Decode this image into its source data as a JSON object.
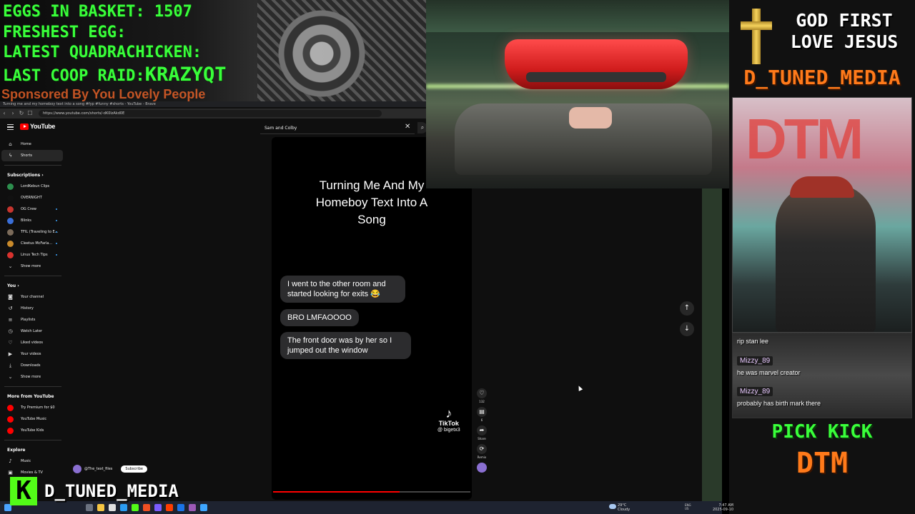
{
  "overlay": {
    "eggs_in_basket": "EGGS IN BASKET: 1507",
    "freshest_egg": "FRESHEST EGG:",
    "latest_quadrachicken": "LATEST QUADRACHICKEN:",
    "last_coop_raid_label": "LAST COOP RAID:",
    "last_coop_raid_value": "KRAZYQT",
    "sponsored": "Sponsored By You Lovely People",
    "god_first_line1": "GOD FIRST",
    "god_first_line2": "LOVE JESUS",
    "channel_header": "D_TUNED_MEDIA",
    "pick_kick": "PICK KICK",
    "dtm_footer": "DTM",
    "kick_brand_letter": "K",
    "kick_brand_name": "D_TUNED_MEDIA",
    "face_cam_sign": "DTM"
  },
  "browser": {
    "tab_title": "Turning me and my homeboy text into a song #fyp #funny #shorts - YouTube - Brave",
    "url": "https://www.youtube.com/shorts/-dK0lzAkd0E",
    "nav": {
      "back": "‹",
      "forward": "›",
      "reload": "↻",
      "bookmark": "☐"
    }
  },
  "youtube": {
    "logo_text": "YouTube",
    "search_value": "Sam and Colby",
    "search_clear": "✕",
    "search_icon": "⌕",
    "sidebar": {
      "main": [
        {
          "label": "Home",
          "icon": "home-icon",
          "glyph": "⌂"
        },
        {
          "label": "Shorts",
          "icon": "shorts-icon",
          "glyph": "ϟ",
          "active": true
        }
      ],
      "subscriptions_header": "Subscriptions  ›",
      "subscriptions": [
        {
          "label": "LordKebun Clips",
          "color": "#2d8f4e"
        },
        {
          "label": "OVERNIGHT",
          "color": "#111111"
        },
        {
          "label": "OG Crew",
          "color": "#c7352e"
        },
        {
          "label": "Blinks",
          "color": "#3a6fd8"
        },
        {
          "label": "TFIL (Traveling to E...",
          "color": "#7b6b5a"
        },
        {
          "label": "Cleetus McFarla...",
          "color": "#c98a2b"
        },
        {
          "label": "Linus Tech Tips",
          "color": "#d8322e"
        }
      ],
      "show_more_1": "Show more",
      "you_header": "You  ›",
      "you_items": [
        {
          "label": "Your channel",
          "icon": "your-channel-icon",
          "glyph": "◙"
        },
        {
          "label": "History",
          "icon": "history-icon",
          "glyph": "↺"
        },
        {
          "label": "Playlists",
          "icon": "playlists-icon",
          "glyph": "≡"
        },
        {
          "label": "Watch Later",
          "icon": "watch-later-icon",
          "glyph": "◷"
        },
        {
          "label": "Liked videos",
          "icon": "liked-videos-icon",
          "glyph": "♡"
        },
        {
          "label": "Your videos",
          "icon": "your-videos-icon",
          "glyph": "▶"
        },
        {
          "label": "Downloads",
          "icon": "downloads-icon",
          "glyph": "⤓"
        }
      ],
      "show_more_2": "Show more",
      "more_header": "More from YouTube",
      "more_items": [
        {
          "label": "Try Premium for $0",
          "color": "#ff0000"
        },
        {
          "label": "YouTube Music",
          "color": "#ff0000"
        },
        {
          "label": "YouTube Kids",
          "color": "#ff0000"
        }
      ],
      "explore_header": "Explore",
      "explore_items": [
        {
          "label": "Music",
          "icon": "music-icon",
          "glyph": "♪"
        },
        {
          "label": "Movies & TV",
          "icon": "movies-icon",
          "glyph": "▣"
        }
      ]
    },
    "short": {
      "title_line1": "Turning Me And My",
      "title_line2": "Homeboy Text Into A",
      "title_line3": "Song",
      "bubble1": "I went to the other room and started looking for exits 😂",
      "bubble2": "BRO LMFAOOOO",
      "bubble3": "The front door was by her so I jumped out the window",
      "tiktok_name": "TikTok",
      "tiktok_handle": "@ bigetx3",
      "progress": 0.64,
      "channel_name": "@The_text_files",
      "subscribe": "Subscribe"
    },
    "actions": [
      {
        "name": "like",
        "glyph": "♡",
        "label": "132"
      },
      {
        "name": "comments",
        "glyph": "▤",
        "label": "6"
      },
      {
        "name": "share",
        "glyph": "➦",
        "label": "Share"
      },
      {
        "name": "remix",
        "glyph": "⟳",
        "label": "Remix"
      }
    ],
    "scroll_up": "↑",
    "scroll_down": "↓"
  },
  "chat": [
    {
      "user": "",
      "text": "rip stan lee"
    },
    {
      "user": "Mizzy_89",
      "text": "he was marvel creator"
    },
    {
      "user": "Mizzy_89",
      "text": "probably has birth mark there"
    }
  ],
  "taskbar": {
    "weather_temp": "29°C",
    "weather_desc": "Cloudy",
    "lang_line1": "ENG",
    "lang_line2": "US",
    "time": "7:47 AM",
    "date": "2025-09-10"
  }
}
